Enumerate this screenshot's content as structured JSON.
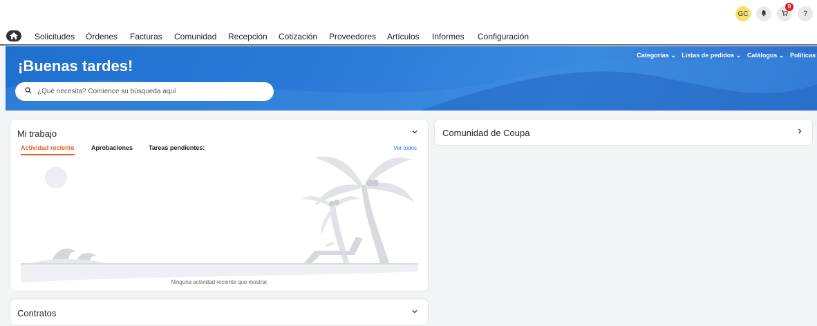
{
  "header": {
    "avatar_initials": "GC",
    "cart_count": "0",
    "help_label": "?"
  },
  "nav": {
    "items": [
      "Solicitudes",
      "Órdenes",
      "Facturas",
      "Comunidad",
      "Recepción",
      "Cotización",
      "Proveedores",
      "Artículos",
      "Informes",
      "Configuración"
    ]
  },
  "hero": {
    "greeting": "¡Buenas tardes!",
    "links": [
      "Categorías ⌄",
      "Listas de pedidos ⌄",
      "Catálogos ⌄",
      "Políticas ⌄"
    ],
    "search_placeholder": "¿Qué necesita? Comience su búsqueda aquí"
  },
  "mi_trabajo": {
    "title": "Mi trabajo",
    "tabs": [
      "Actividad reciente",
      "Aprobaciones",
      "Tareas pendientes:"
    ],
    "see_all": "Ver todos",
    "empty_message": "Ninguna actividad reciente que mostrar"
  },
  "comunidad": {
    "title": "Comunidad de Coupa"
  },
  "contratos": {
    "title": "Contratos"
  },
  "icons": {
    "home": "home-icon",
    "bell": "bell-icon",
    "cart": "cart-icon",
    "search": "search-icon",
    "chevron_down": "chevron-down-icon",
    "chevron_right": "chevron-right-icon"
  },
  "colors": {
    "hero_blue": "#2a7ad8",
    "active_tab": "#e0662a",
    "link_blue": "#2f7ad6",
    "badge_red": "#dd2222",
    "avatar_yellow": "#f7e06a"
  }
}
